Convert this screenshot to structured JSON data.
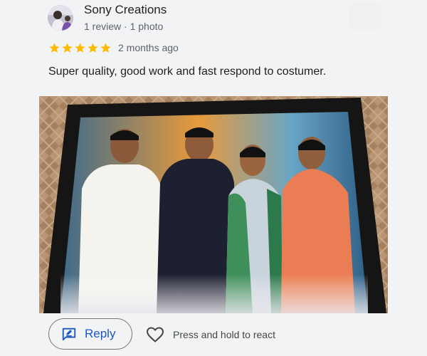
{
  "review": {
    "reviewer_name": "Sony Creations",
    "reviewer_meta": "1 review · 1 photo",
    "rating": 5,
    "rating_max": 5,
    "date": "2 months ago",
    "text": "Super quality, good work and fast respond to costumer."
  },
  "actions": {
    "reply_label": "Reply",
    "react_label": "Press and hold to react"
  },
  "colors": {
    "star": "#fbbc04",
    "reply_text": "#1a56c4",
    "reply_icon": "#1a56c4",
    "secondary_text": "#5f6368",
    "background": "#f2f3f5"
  },
  "icons": {
    "star": "star-icon",
    "reply": "reply-icon",
    "react": "heart-icon"
  }
}
